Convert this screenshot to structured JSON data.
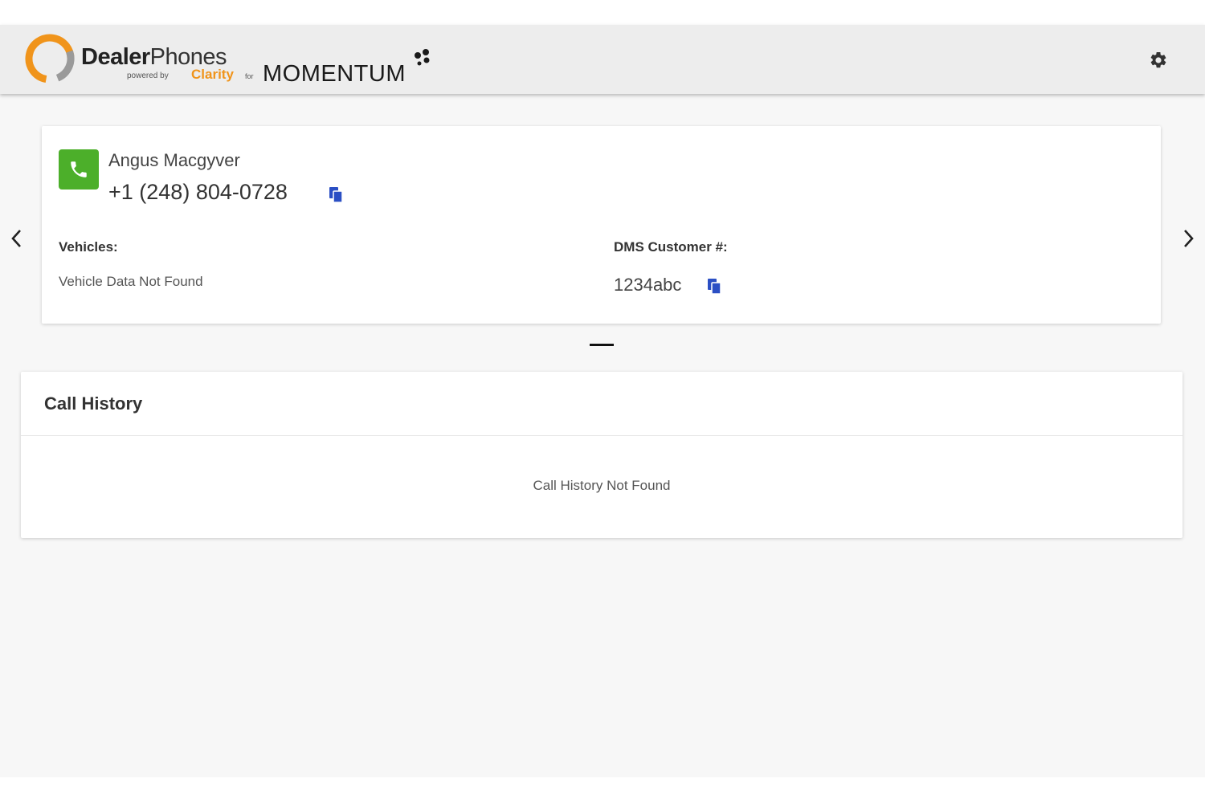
{
  "brand": {
    "dealer": "Dealer",
    "phones": "Phones",
    "powered_by": "powered by",
    "clarity": "Clarity",
    "for": "for",
    "momentum": "MOMENTUM"
  },
  "header": {
    "settings_icon": "gear-icon"
  },
  "navigation": {
    "prev_icon": "chevron-left-icon",
    "next_icon": "chevron-right-icon"
  },
  "contact": {
    "name": "Angus Macgyver",
    "phone": "+1 (248) 804-0728",
    "vehicles_label": "Vehicles:",
    "vehicles_value": "Vehicle Data Not Found",
    "dms_label": "DMS Customer #:",
    "dms_value": "1234abc"
  },
  "call_history": {
    "title": "Call History",
    "empty_message": "Call History Not Found"
  },
  "colors": {
    "accent_green": "#4caf2a",
    "copy_blue": "#2b4fc4",
    "brand_orange": "#f0941b"
  }
}
